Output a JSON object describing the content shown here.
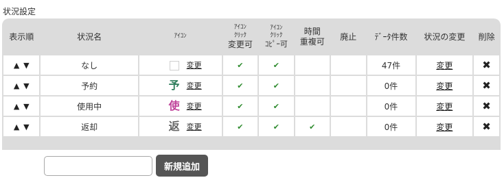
{
  "section_title": "状況設定",
  "headers": {
    "order": "表示順",
    "name": "状況名",
    "icon": "ｱｲｺﾝ",
    "icon_change_1": "ｱｲｺﾝ",
    "icon_change_2": "ｸﾘｯｸ",
    "icon_change_3": "変更可",
    "icon_copy_1": "ｱｲｺﾝ",
    "icon_copy_2": "ｸﾘｯｸ",
    "icon_copy_3": "ｺﾋﾟｰ可",
    "time_dup_1": "時間",
    "time_dup_2": "重複可",
    "abolished": "廃止",
    "count": "ﾃﾞｰﾀ件数",
    "status_change": "状況の変更",
    "delete": "削除"
  },
  "arrow_up": "▲",
  "arrow_down": "▼",
  "icon_change_label": "変更",
  "change_label": "変更",
  "delete_symbol": "✖",
  "check_mark": "✔",
  "rows": [
    {
      "name": "なし",
      "icon_char": "",
      "icon_color": "",
      "icon_change": true,
      "icon_copy": true,
      "time_dup": false,
      "abolished": false,
      "count": "47件"
    },
    {
      "name": "予約",
      "icon_char": "予",
      "icon_color": "#2e7d5b",
      "icon_change": true,
      "icon_copy": true,
      "time_dup": false,
      "abolished": false,
      "count": "0件"
    },
    {
      "name": "使用中",
      "icon_char": "使",
      "icon_color": "#c0439a",
      "icon_change": true,
      "icon_copy": true,
      "time_dup": false,
      "abolished": false,
      "count": "0件"
    },
    {
      "name": "返却",
      "icon_char": "返",
      "icon_color": "#666666",
      "icon_change": true,
      "icon_copy": true,
      "time_dup": true,
      "abolished": false,
      "count": "0件"
    }
  ],
  "new_input": {
    "value": "",
    "placeholder": ""
  },
  "add_button_label": "新規追加"
}
